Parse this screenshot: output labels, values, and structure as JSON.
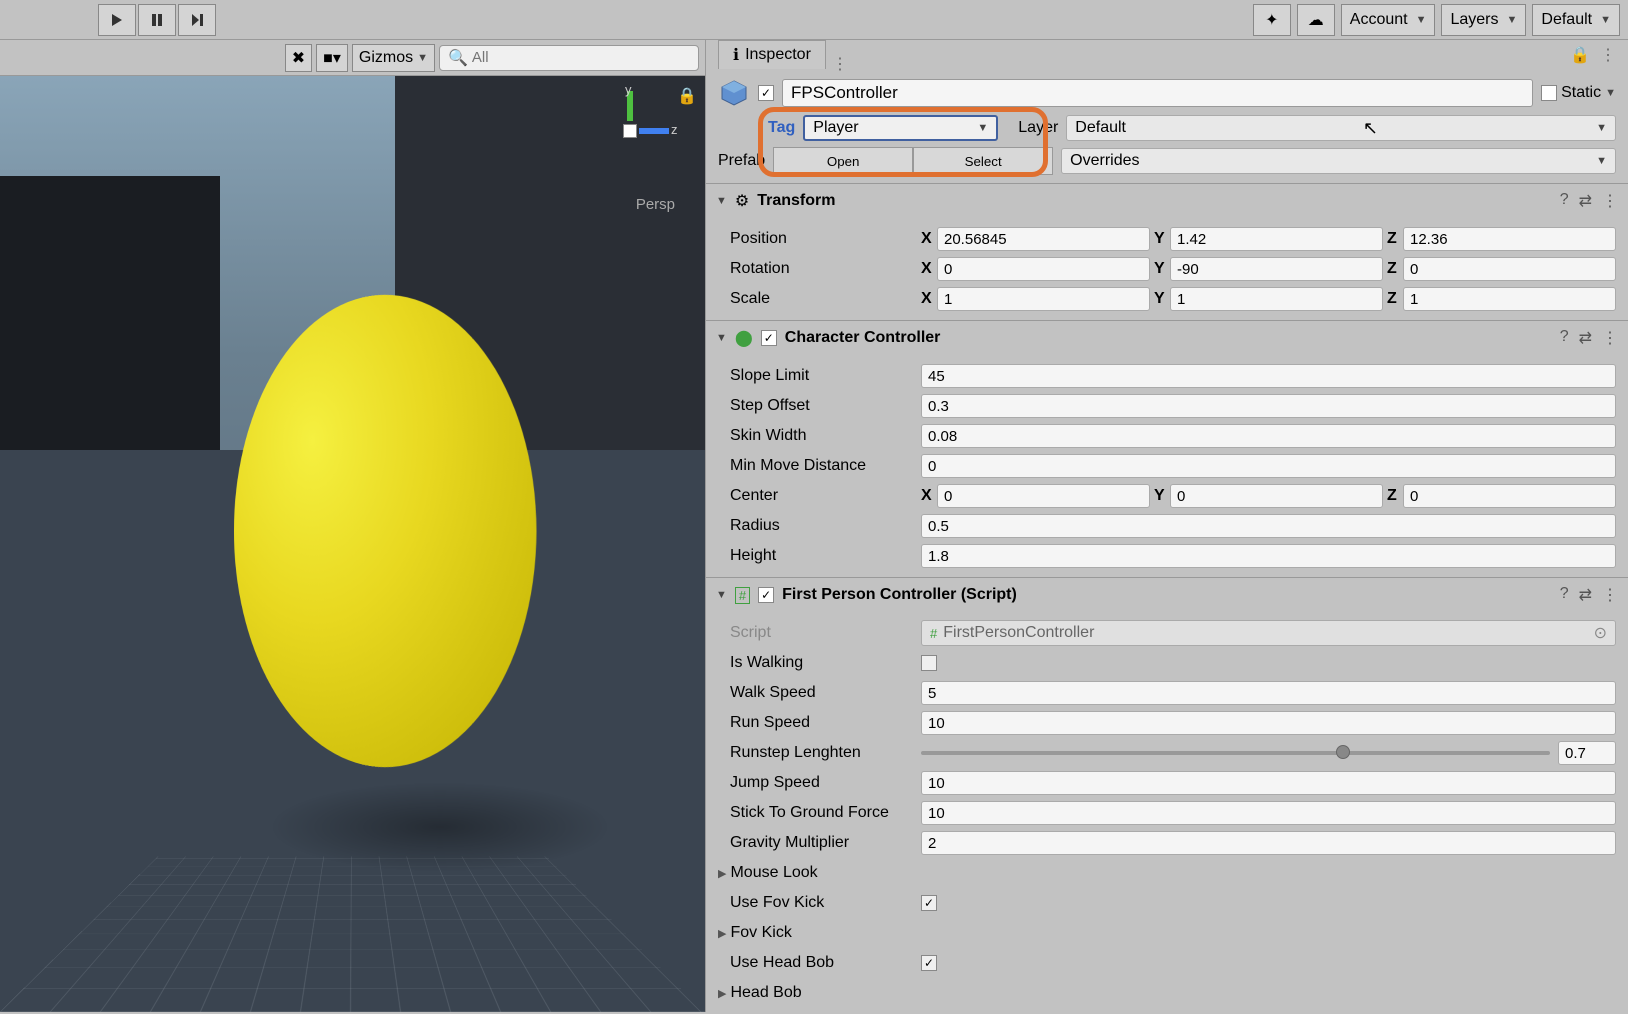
{
  "toolbar": {
    "account": "Account",
    "layers": "Layers",
    "layout": "Default"
  },
  "scene": {
    "gizmos": "Gizmos",
    "search_placeholder": "All",
    "persp": "Persp",
    "axis_y": "y",
    "axis_z": "z"
  },
  "inspector": {
    "tab": "Inspector",
    "name": "FPSController",
    "static": "Static",
    "tag_label": "Tag",
    "tag_value": "Player",
    "layer_label": "Layer",
    "layer_value": "Default",
    "prefab_label": "Prefab",
    "open": "Open",
    "select": "Select",
    "overrides": "Overrides"
  },
  "transform": {
    "title": "Transform",
    "position": "Position",
    "pos_x": "20.56845",
    "pos_y": "1.42",
    "pos_z": "12.36",
    "rotation": "Rotation",
    "rot_x": "0",
    "rot_y": "-90",
    "rot_z": "0",
    "scale": "Scale",
    "scl_x": "1",
    "scl_y": "1",
    "scl_z": "1"
  },
  "charctrl": {
    "title": "Character Controller",
    "slope_limit": "Slope Limit",
    "slope_limit_v": "45",
    "step_offset": "Step Offset",
    "step_offset_v": "0.3",
    "skin_width": "Skin Width",
    "skin_width_v": "0.08",
    "min_move": "Min Move Distance",
    "min_move_v": "0",
    "center": "Center",
    "cx": "0",
    "cy": "0",
    "cz": "0",
    "radius": "Radius",
    "radius_v": "0.5",
    "height": "Height",
    "height_v": "1.8"
  },
  "fps": {
    "title": "First Person Controller (Script)",
    "script": "Script",
    "script_v": "FirstPersonController",
    "is_walking": "Is Walking",
    "walk_speed": "Walk Speed",
    "walk_speed_v": "5",
    "run_speed": "Run Speed",
    "run_speed_v": "10",
    "runstep": "Runstep Lenghten",
    "runstep_v": "0.7",
    "jump_speed": "Jump Speed",
    "jump_speed_v": "10",
    "stick": "Stick To Ground Force",
    "stick_v": "10",
    "gravity": "Gravity Multiplier",
    "gravity_v": "2",
    "mouse_look": "Mouse Look",
    "use_fov": "Use Fov Kick",
    "fov_kick": "Fov Kick",
    "use_head_bob": "Use Head Bob",
    "head_bob": "Head Bob"
  },
  "labels": {
    "x": "X",
    "y": "Y",
    "z": "Z"
  }
}
